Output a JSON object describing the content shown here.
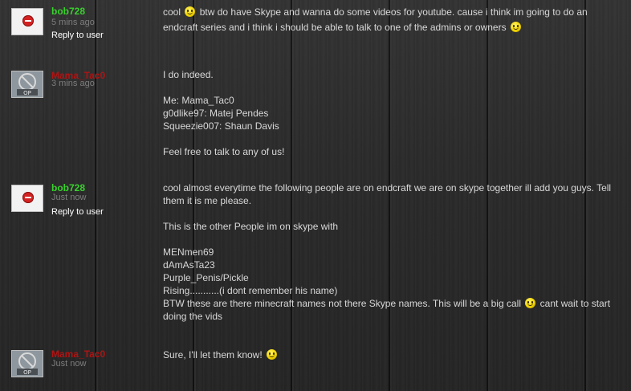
{
  "comments": [
    {
      "username": "bob728",
      "timestamp": "5 mins ago",
      "reply": "Reply to user",
      "lines": [
        "cool",
        "btw do have Skype and wanna do some videos for youtube. cause i think im going to do an",
        "endcraft series and i think i should be able to talk to one of the admins or owners"
      ]
    },
    {
      "username": "Mama_Tac0",
      "timestamp": "3 mins ago",
      "lines": [
        "I do indeed.",
        "Me: Mama_Tac0",
        "g0dlike97: Matej Pendes",
        "Squeezie007: Shaun Davis",
        "Feel free to talk to any of us!"
      ]
    },
    {
      "username": "bob728",
      "timestamp": "Just now",
      "reply": "Reply to user",
      "lines": [
        "cool almost everytime the following people are on endcraft we are on skype together ill add you guys. Tell",
        "them it is me please.",
        "This is the other People im on skype with",
        "MENmen69",
        "dAmAsTa23",
        "Purple_Penis/Pickle",
        "Rising...........(i dont remember his name)",
        "BTW these are there minecraft names not there Skype names. This will be a big call",
        "cant wait to start",
        "doing the vids"
      ]
    },
    {
      "username": "Mama_Tac0",
      "timestamp": "Just now",
      "lines": [
        "Sure, I'll let them know!"
      ]
    }
  ],
  "colors": {
    "username_green": "#39d12d",
    "username_red": "#b01313"
  },
  "icons": {
    "smiley": "smiley-icon",
    "blocked_avatar": "no-entry-icon"
  }
}
